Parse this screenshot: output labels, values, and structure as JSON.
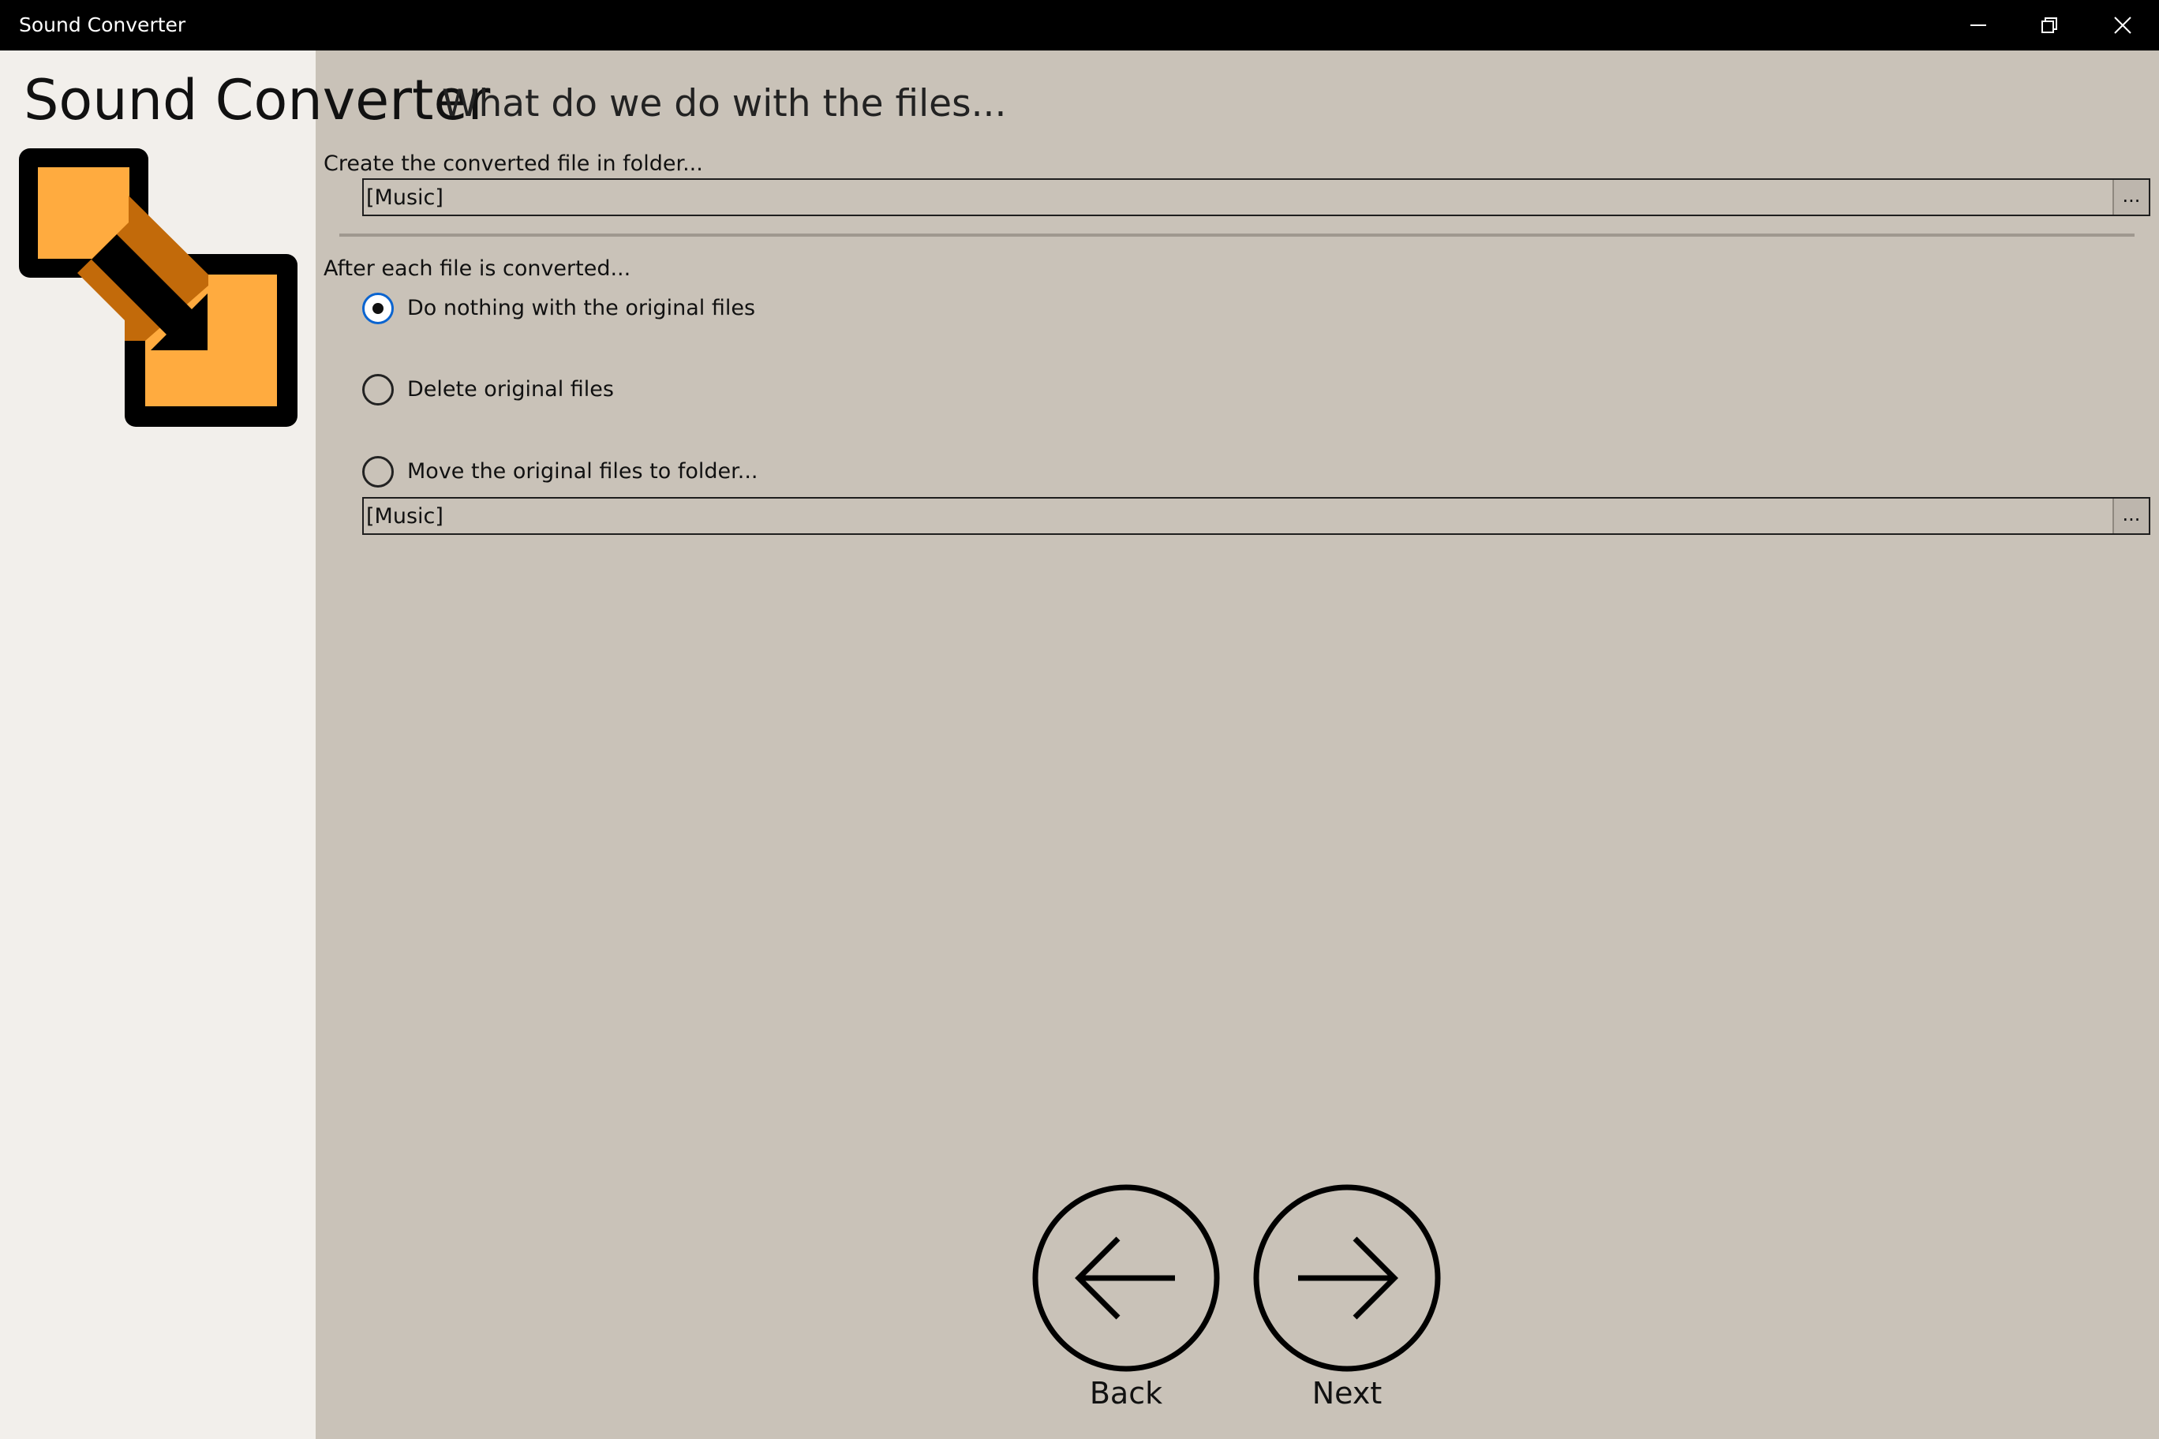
{
  "window": {
    "title": "Sound Converter",
    "controls": {
      "minimize": "minimize-icon",
      "restore": "restore-icon",
      "close": "close-icon"
    }
  },
  "header": {
    "app_name": "Sound Converter",
    "subtitle": "What do we do with the files..."
  },
  "logo": {
    "icon": "convert-arrow-logo",
    "colors": {
      "fill": "#ffab3f",
      "shadow": "#c26a0a",
      "outline": "#000000"
    }
  },
  "output_folder": {
    "label": "Create the converted file in folder...",
    "value": "[Music]",
    "browse_label": "..."
  },
  "after_convert": {
    "label": "After each file is converted...",
    "options": [
      {
        "label": "Do nothing with the original files",
        "checked": true
      },
      {
        "label": "Delete original files",
        "checked": false
      },
      {
        "label": "Move the original files to folder...",
        "checked": false
      }
    ],
    "move_folder": {
      "value": "[Music]",
      "browse_label": "..."
    }
  },
  "navigation": {
    "back_label": "Back",
    "next_label": "Next"
  },
  "colors": {
    "main_bg": "#c9c2b8",
    "left_pane_bg": "#f2efeb",
    "titlebar_bg": "#000000",
    "radio_accent": "#0a64d0"
  }
}
